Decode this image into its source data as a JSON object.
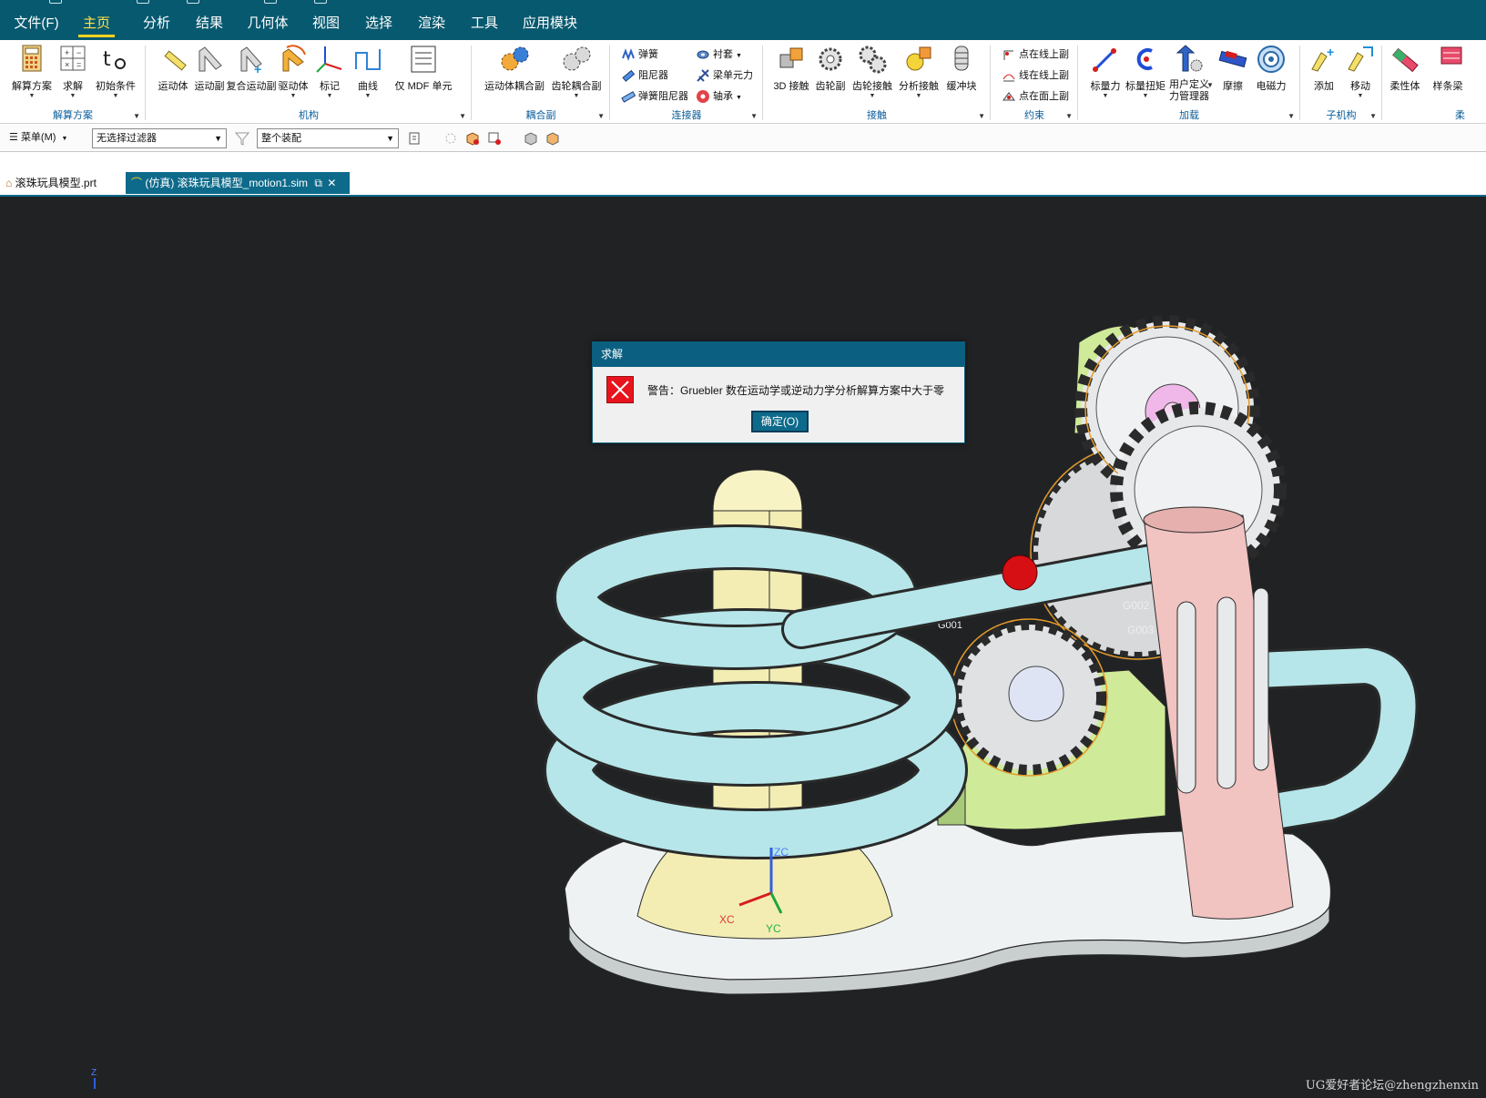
{
  "menubar": {
    "items": [
      "文件(F)",
      "主页",
      "分析",
      "结果",
      "几何体",
      "视图",
      "选择",
      "渲染",
      "工具",
      "应用模块"
    ],
    "active_index": 1
  },
  "ribbon": {
    "groups": {
      "solution": {
        "label": "解算方案",
        "buttons": [
          "解算方案",
          "求解",
          "初始条件"
        ]
      },
      "mechanism": {
        "label": "机构",
        "buttons": [
          "运动体",
          "运动副",
          "复合运动副",
          "驱动体",
          "标记",
          "曲线",
          "仅 MDF 单元"
        ]
      },
      "coupler": {
        "label": "耦合副",
        "buttons": [
          "运动体耦合副",
          "齿轮耦合副"
        ]
      },
      "connector": {
        "label": "连接器",
        "items": [
          "弹簧",
          "阻尼器",
          "弹簧阻尼器",
          "衬套",
          "梁单元力",
          "轴承"
        ]
      },
      "contact": {
        "label": "接触",
        "buttons": [
          "3D 接触",
          "齿轮副",
          "齿轮接触",
          "分析接触",
          "缓冲块"
        ]
      },
      "constraint": {
        "label": "约束",
        "items": [
          "点在线上副",
          "线在线上副",
          "点在面上副"
        ]
      },
      "load": {
        "label": "加载",
        "buttons": [
          "标量力",
          "标量扭矩",
          "用户定义",
          "力管理器",
          "摩擦",
          "电磁力"
        ]
      },
      "submech": {
        "label": "子机构",
        "buttons": [
          "添加",
          "移动"
        ]
      },
      "flex": {
        "label": "柔",
        "buttons": [
          "柔性体",
          "样条梁"
        ]
      }
    }
  },
  "toolbar": {
    "menu_label": "菜单(M)",
    "filter_value": "无选择过滤器",
    "assembly_value": "整个装配"
  },
  "tabs": [
    {
      "label": "滚珠玩具模型.prt",
      "active": false
    },
    {
      "label": "(仿真) 滚珠玩具模型_motion1.sim",
      "active": true
    }
  ],
  "viewport": {
    "labels": {
      "zc": "ZC",
      "xc": "XC",
      "yc": "YC",
      "z": "Z",
      "g002": "G002",
      "g003": "G003",
      "g001": "G001"
    },
    "watermark": "UG爱好者论坛@zhengzhenxin"
  },
  "dialog": {
    "title": "求解",
    "message": "警告：Gruebler 数在运动学或逆动力学分析解算方案中大于零",
    "ok_label": "确定(O)"
  },
  "colors": {
    "menubar": "#07596f",
    "viewport_bg": "#202224",
    "track": "#b6e6e9",
    "pillar": "#f3edb4",
    "tube": "#f1c3c1",
    "base_plate": "#eaf0f0",
    "green_bracket": "#cfeb9a",
    "gear": "#e2e4e6",
    "ball": "#d60f15"
  }
}
